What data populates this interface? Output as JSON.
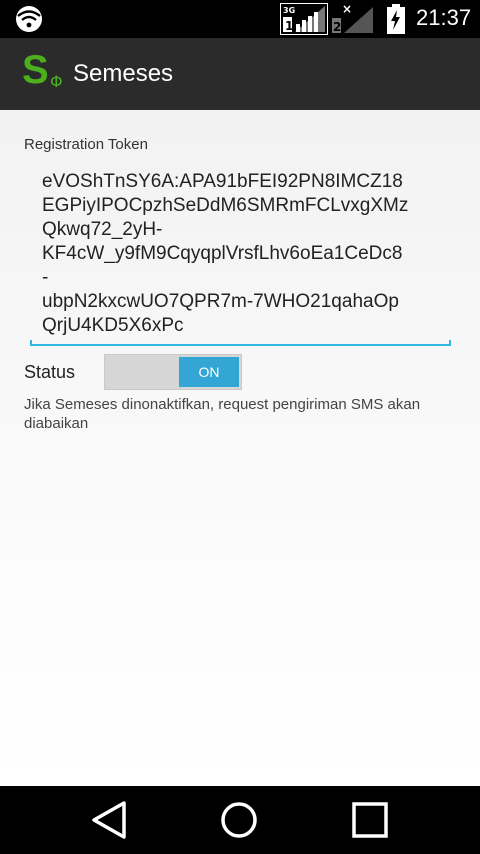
{
  "status_bar": {
    "network_type": "3G",
    "sim1_label": "1",
    "sim2_label": "2",
    "time": "21:37"
  },
  "action_bar": {
    "logo_letter": "S",
    "logo_symbol": "Φ",
    "title": "Semeses"
  },
  "form": {
    "token_label": "Registration Token",
    "token_value": "eVOShTnSY6A:APA91bFEI92PN8IMCZ18EGPiyIPOCpzhSeDdM6SMRmFCLvxgXMzQkwq72_2yH-KF4cW_y9fM9CqyqplVrsfLhv6oEa1CeDc8-ubpN2kxcwUO7QPR7m-7WHO21qahaOpQrjU4KD5X6xPc",
    "status_label": "Status",
    "toggle_label": "ON",
    "toggle_on": true,
    "hint": "Jika Semeses dinonaktifkan, request pengiriman SMS akan diabaikan"
  },
  "colors": {
    "accent": "#33b5e5",
    "brand": "#4caf1e",
    "toggle_on": "#33a6d6"
  },
  "icons": {
    "wifi": "wifi-icon",
    "signal": "signal-icon",
    "battery": "battery-charging-icon",
    "back": "back-icon",
    "home": "home-icon",
    "recent": "recent-apps-icon"
  }
}
